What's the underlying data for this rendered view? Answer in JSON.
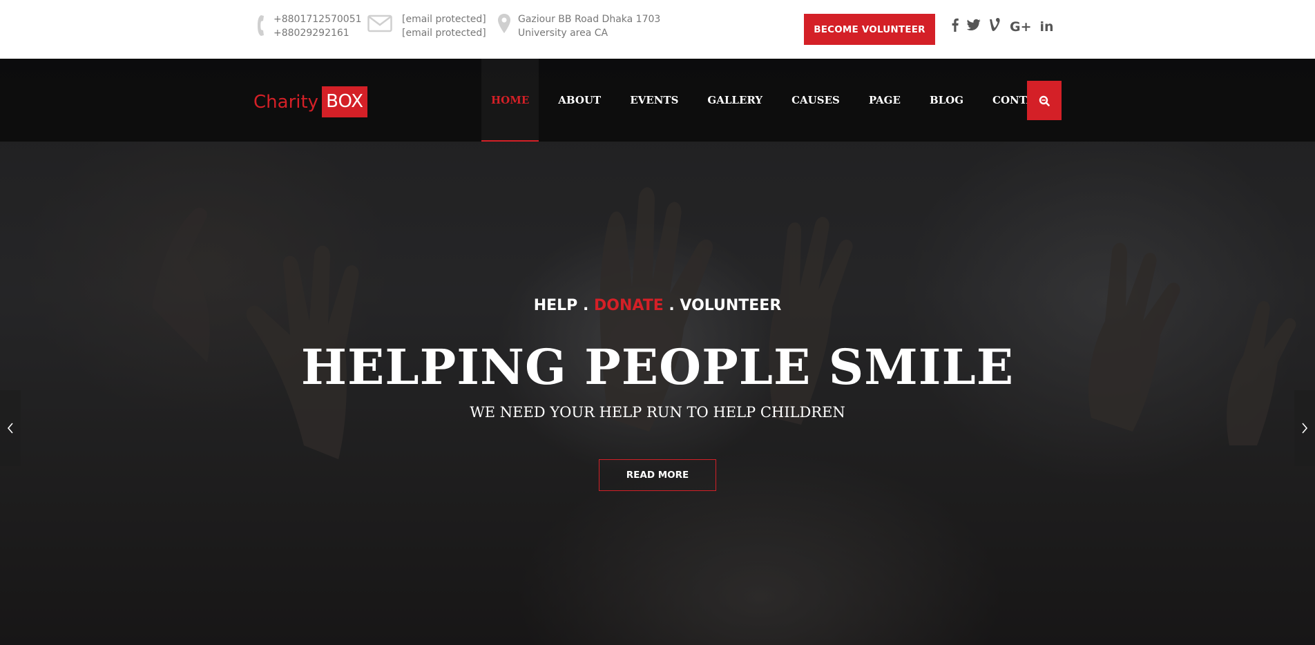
{
  "topbar": {
    "phone": {
      "icon": "phone-icon",
      "line1": "+8801712570051",
      "line2": "+88029292161"
    },
    "email": {
      "icon": "envelope-icon",
      "line1": "[email protected]",
      "line2": "[email protected]"
    },
    "address": {
      "icon": "map-marker-icon",
      "line1": "Gaziour BB Road Dhaka 1703",
      "line2": "University area CA"
    },
    "volunteer_button": "BECOME VOLUNTEER",
    "social": [
      "facebook-icon",
      "twitter-icon",
      "vine-icon",
      "google-plus-icon",
      "linkedin-icon"
    ]
  },
  "logo": {
    "charity": "Charity",
    "box": "BOX"
  },
  "nav": {
    "items": [
      {
        "label": "HOME",
        "active": true
      },
      {
        "label": "ABOUT"
      },
      {
        "label": "EVENTS"
      },
      {
        "label": "GALLERY"
      },
      {
        "label": "CAUSES"
      },
      {
        "label": "PAGE"
      },
      {
        "label": "BLOG"
      },
      {
        "label": "CONTACT"
      }
    ],
    "search_icon": "search-icon"
  },
  "hero": {
    "tagline_part1": "HELP .",
    "tagline_part2": "DONATE",
    "tagline_part3": ". VOLUNTEER",
    "title": "HELPING PEOPLE SMILE",
    "subtitle": "WE NEED YOUR HELP RUN TO HELP CHILDREN",
    "button": "READ MORE"
  },
  "colors": {
    "accent": "#d42027",
    "navbar": "#0f0f0f",
    "text_muted": "#777777"
  }
}
